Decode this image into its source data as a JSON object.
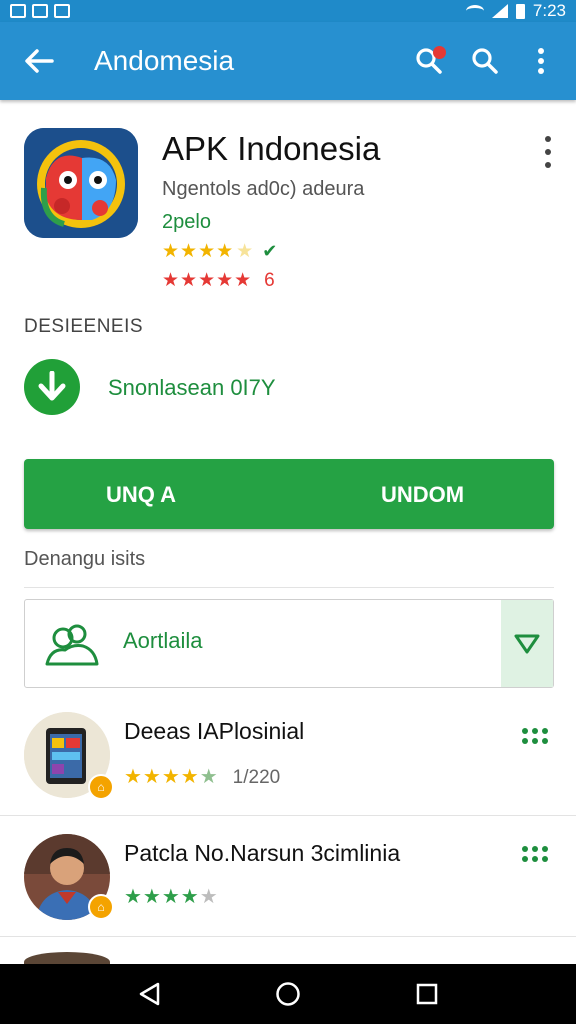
{
  "status_bar": {
    "time": "7:23"
  },
  "app_bar": {
    "title": "Andomesia"
  },
  "app": {
    "name": "APK Indonesia",
    "developer": "Ngentols ad0c) adeura",
    "size": "2pelo",
    "rating_yellow": "★★★★",
    "rating_yellow_dim": "★",
    "rating_red": "★★★★★",
    "rating_red_count": "6"
  },
  "section": {
    "label": "DESIEENEIS"
  },
  "download": {
    "status_text": "Snonlasean 0I7Y"
  },
  "install_button": {
    "left_label": "UNQ A",
    "right_label": "UNDOM"
  },
  "dependencies": {
    "label": "Denangu isits"
  },
  "selector": {
    "value": "Aortlaila"
  },
  "list": [
    {
      "title": "Deeas IAPlosinial",
      "stars": "★★★★",
      "stars_dim": "★",
      "count": "1/220"
    },
    {
      "title": "Patcla No.Narsun 3cimlinia",
      "stars": "★★★★",
      "stars_dim": "★",
      "count": ""
    }
  ],
  "colors": {
    "app_bar": "#2790d0",
    "status_bar": "#1f8ac9",
    "primary_green": "#25a244",
    "accent_red": "#e53935",
    "star_yellow": "#f2b400"
  }
}
